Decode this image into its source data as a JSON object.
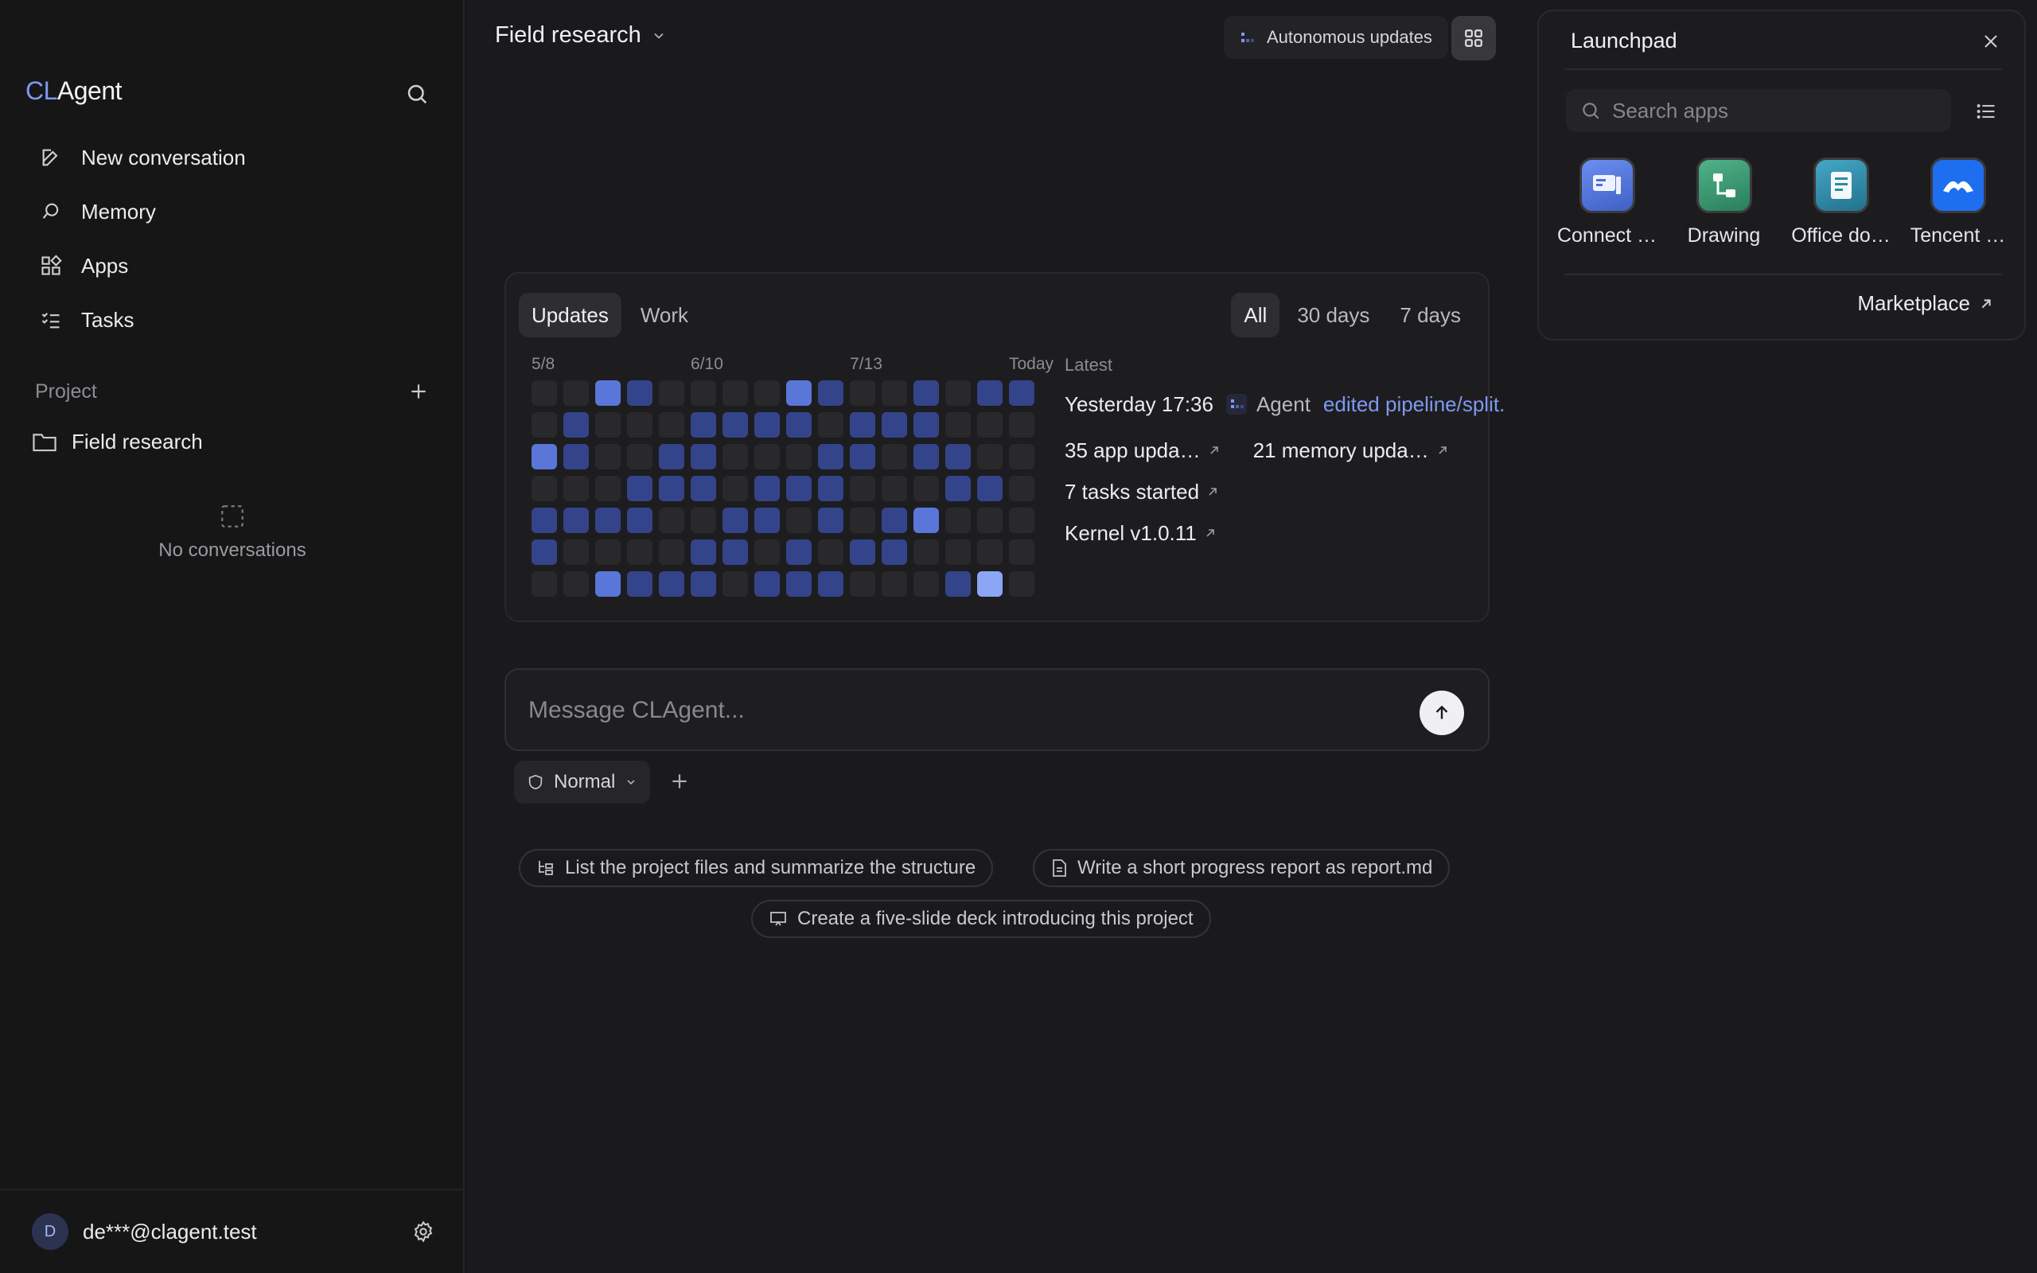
{
  "sidebar": {
    "logo_prefix": "CL",
    "logo_suffix": "Agent",
    "nav": [
      {
        "label": "New conversation",
        "icon": "edit-icon"
      },
      {
        "label": "Memory",
        "icon": "memory-icon"
      },
      {
        "label": "Apps",
        "icon": "apps-icon"
      },
      {
        "label": "Tasks",
        "icon": "tasks-icon"
      }
    ],
    "project_label": "Project",
    "project_item": "Field research",
    "empty_text": "No conversations",
    "user_initial": "D",
    "user_email": "de***@clagent.test"
  },
  "header": {
    "title": "Field research",
    "autonomous_label": "Autonomous updates"
  },
  "activity": {
    "tabs": [
      "Updates",
      "Work"
    ],
    "active_tab": "Updates",
    "ranges": [
      "All",
      "30 days",
      "7 days"
    ],
    "active_range": "All",
    "date_labels": [
      "5/8",
      "6/10",
      "7/13",
      "Today"
    ],
    "heatmap_levels": [
      [
        0,
        0,
        3,
        2,
        0,
        0,
        0,
        0,
        3,
        2,
        0,
        0,
        2,
        0,
        2,
        2
      ],
      [
        0,
        2,
        0,
        0,
        0,
        2,
        2,
        2,
        2,
        0,
        2,
        2,
        2,
        0,
        0,
        0
      ],
      [
        3,
        2,
        0,
        0,
        2,
        2,
        0,
        0,
        0,
        2,
        2,
        0,
        2,
        2,
        0,
        0
      ],
      [
        0,
        0,
        0,
        2,
        2,
        2,
        0,
        2,
        2,
        2,
        0,
        0,
        0,
        2,
        2,
        0
      ],
      [
        2,
        2,
        2,
        2,
        0,
        0,
        2,
        2,
        0,
        2,
        0,
        2,
        3,
        0,
        0,
        0
      ],
      [
        2,
        0,
        0,
        0,
        0,
        2,
        2,
        0,
        2,
        0,
        2,
        2,
        0,
        0,
        0,
        0
      ],
      [
        0,
        0,
        3,
        2,
        2,
        2,
        0,
        2,
        2,
        2,
        0,
        0,
        0,
        2,
        4,
        0
      ]
    ],
    "latest_label": "Latest",
    "latest_time": "Yesterday 17:36",
    "latest_actor": "Agent",
    "latest_action": "edited pipeline/split.",
    "stats": [
      "35 app upda…",
      "21 memory upda…",
      "7 tasks started",
      "Kernel v1.0.11"
    ]
  },
  "composer": {
    "placeholder": "Message CLAgent...",
    "mode": "Normal"
  },
  "suggestions": [
    "List the project files and summarize the structure",
    "Write a short progress report as report.md",
    "Create a five-slide deck introducing this project"
  ],
  "launchpad": {
    "title": "Launchpad",
    "search_placeholder": "Search apps",
    "apps": [
      {
        "label": "Connect …",
        "icon": "connect-app-icon",
        "color": "#4a6fd8"
      },
      {
        "label": "Drawing",
        "icon": "drawing-app-icon",
        "color": "#3c9a6e"
      },
      {
        "label": "Office do…",
        "icon": "office-docs-app-icon",
        "color": "#2d8aa6"
      },
      {
        "label": "Tencent …",
        "icon": "tencent-app-icon",
        "color": "#1e6ff0"
      }
    ],
    "marketplace_label": "Marketplace"
  },
  "colors": {
    "accent": "#7f98f0",
    "heat_levels": [
      "#29292c",
      "#2a3566",
      "#34448a",
      "#5a76d8",
      "#8aa6f5"
    ]
  }
}
